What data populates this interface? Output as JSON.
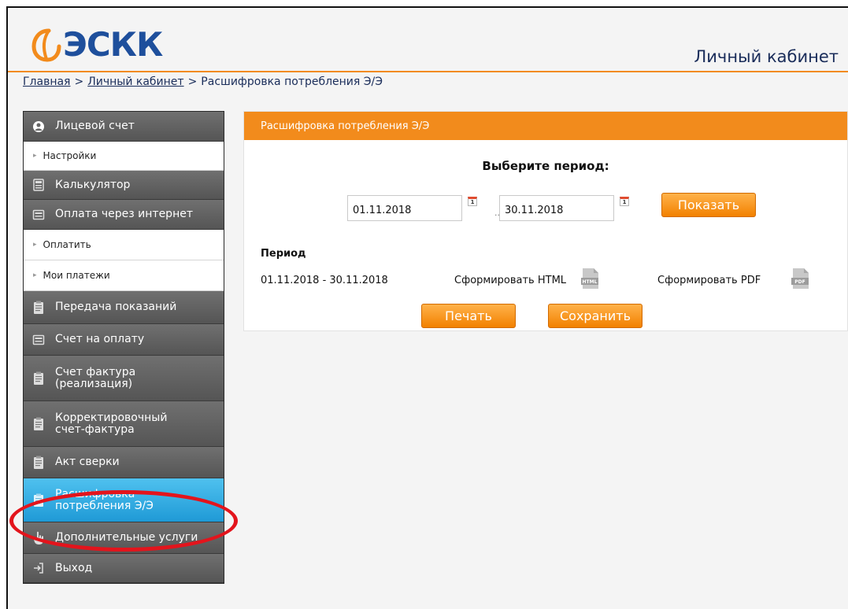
{
  "header": {
    "logo_text": "ЭСКК",
    "cabinet_title": "Личный кабинет"
  },
  "breadcrumb": {
    "home": "Главная",
    "separator": ">",
    "cabinet": "Личный кабинет",
    "current": "Расшифровка потребления Э/Э"
  },
  "sidebar": {
    "personal_account": "Лицевой счет",
    "settings": "Настройки",
    "calculator": "Калькулятор",
    "online_payment": "Оплата через интернет",
    "pay": "Оплатить",
    "my_payments": "Мои платежи",
    "meter_readings": "Передача показаний",
    "invoice": "Счет на оплату",
    "invoice_factura": "Счет фактура (реализация)",
    "corrective_invoice": "Корректировочный счет-фактура",
    "reconciliation": "Акт сверки",
    "consumption_breakdown": "Расшифровка потребления Э/Э",
    "additional_services": "Дополнительные услуги",
    "exit": "Выход",
    "icons": {
      "personal_account": "user-circle-icon",
      "calculator": "calculator-icon",
      "online_payment": "card-icon",
      "meter_readings": "clipboard-icon",
      "invoice": "card-icon",
      "invoice_factura": "document-icon",
      "corrective_invoice": "document-icon",
      "reconciliation": "document-icon",
      "consumption_breakdown": "document-icon",
      "additional_services": "hand-pointer-icon",
      "exit": "exit-icon"
    }
  },
  "panel": {
    "title": "Расшифровка потребления Э/Э",
    "choose_period": "Выберите период:",
    "date_from": "01.11.2018",
    "date_to": "30.11.2018",
    "ellipsis": "...",
    "show_button": "Показать",
    "period_label": "Период",
    "period_value": "01.11.2018 - 30.11.2018",
    "generate_html": "Сформировать HTML",
    "generate_pdf": "Сформировать PDF",
    "html_badge": "HTML",
    "pdf_badge": "PDF",
    "calendar_glyph": "1",
    "print_button": "Печать",
    "save_button": "Сохранить"
  },
  "colors": {
    "accent_orange": "#f28b1c",
    "brand_blue": "#1e4f9c",
    "sidebar_dark": "#5a5a5a",
    "active_blue": "#2aa6e0",
    "highlight_red": "#e3141c"
  }
}
